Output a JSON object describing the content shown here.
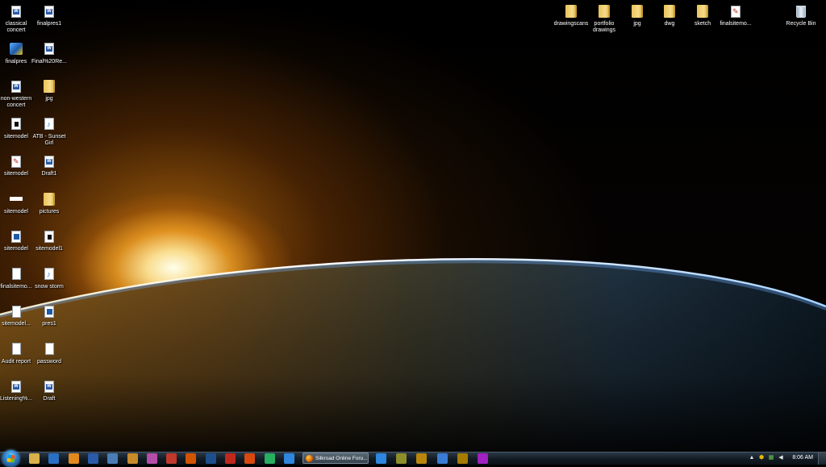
{
  "desktop": {
    "left_icons": [
      {
        "label": "classical concert",
        "icon": "word-doc-icon",
        "kind": "word"
      },
      {
        "label": "finalpres1",
        "icon": "word-doc-icon",
        "kind": "word"
      },
      {
        "label": "finalpres",
        "icon": "program-shortcut-icon",
        "kind": "prog"
      },
      {
        "label": "Final%20Re...",
        "icon": "word-doc-icon",
        "kind": "word"
      },
      {
        "label": "non-western concert",
        "icon": "word-doc-icon",
        "kind": "word"
      },
      {
        "label": "jpg",
        "icon": "folder-icon",
        "kind": "folder"
      },
      {
        "label": "sitemodel",
        "icon": "image-file-icon",
        "kind": "dark"
      },
      {
        "label": "ATB - Sunset Girl",
        "icon": "audio-file-icon",
        "kind": "audio"
      },
      {
        "label": "sitemodel",
        "icon": "autocad-file-icon",
        "kind": "acad"
      },
      {
        "label": "Draft1",
        "icon": "word-doc-icon",
        "kind": "word"
      },
      {
        "label": "sitemodel",
        "icon": "image-file-icon",
        "kind": "flat"
      },
      {
        "label": "pictures",
        "icon": "folder-icon",
        "kind": "folder"
      },
      {
        "label": "sitemodel",
        "icon": "photoshop-file-icon",
        "kind": "pdf"
      },
      {
        "label": "sitemodel1",
        "icon": "image-file-icon",
        "kind": "dark"
      },
      {
        "label": "finalsitemo...",
        "icon": "blank-file-icon",
        "kind": "blank"
      },
      {
        "label": "snow storm",
        "icon": "audio-file-icon",
        "kind": "audio"
      },
      {
        "label": "sitemodel...",
        "icon": "blank-file-icon",
        "kind": "blank"
      },
      {
        "label": "pres1",
        "icon": "photoshop-file-icon",
        "kind": "pdf"
      },
      {
        "label": "Audit report",
        "icon": "blank-file-icon",
        "kind": "blank"
      },
      {
        "label": "password",
        "icon": "blank-file-icon",
        "kind": "blank"
      },
      {
        "label": "Listening%...",
        "icon": "word-doc-icon",
        "kind": "word"
      },
      {
        "label": "Draft",
        "icon": "word-doc-icon",
        "kind": "word"
      }
    ],
    "top_icons": [
      {
        "label": "drawingscans",
        "icon": "folder-icon",
        "kind": "folder"
      },
      {
        "label": "portfolio drawings",
        "icon": "folder-icon",
        "kind": "folder"
      },
      {
        "label": "jpg",
        "icon": "folder-icon",
        "kind": "folder"
      },
      {
        "label": "dwg",
        "icon": "folder-icon",
        "kind": "folder"
      },
      {
        "label": "sketch",
        "icon": "folder-icon",
        "kind": "folder"
      },
      {
        "label": "finalsitemo...",
        "icon": "autocad-file-icon",
        "kind": "acad"
      }
    ],
    "recycle_bin": {
      "label": "Recycle Bin",
      "icon": "recycle-bin-icon"
    }
  },
  "taskbar": {
    "pinned_left": [
      {
        "icon": "folder-icon",
        "color": "#d9b14a"
      },
      {
        "icon": "word-icon",
        "color": "#2a6fc4"
      },
      {
        "icon": "media-player-icon",
        "color": "#e08a1e"
      },
      {
        "icon": "word-icon",
        "color": "#2a5ba8"
      },
      {
        "icon": "document-icon",
        "color": "#4a7db5"
      },
      {
        "icon": "folder-icon",
        "color": "#c98a2a"
      },
      {
        "icon": "photo-icon",
        "color": "#b44da8"
      },
      {
        "icon": "calendar-icon",
        "color": "#c0392b"
      },
      {
        "icon": "powerpoint-icon",
        "color": "#d35400"
      },
      {
        "icon": "photoshop-icon",
        "color": "#1e4f8c"
      },
      {
        "icon": "autocad-icon",
        "color": "#c0281c"
      },
      {
        "icon": "firefox-icon",
        "color": "#d9480f"
      },
      {
        "icon": "chat-icon",
        "color": "#27ae60"
      },
      {
        "icon": "blue-app-icon",
        "color": "#2e86de"
      }
    ],
    "active_task": {
      "label": "Silkroad Online Foru...",
      "icon": "firefox-icon"
    },
    "pinned_right": [
      {
        "icon": "ie-icon",
        "color": "#2e86de"
      },
      {
        "icon": "game-icon",
        "color": "#8e8e2a"
      },
      {
        "icon": "game2-icon",
        "color": "#b8860b"
      },
      {
        "icon": "globe-icon",
        "color": "#3a7bd5"
      },
      {
        "icon": "warcraft-icon",
        "color": "#a67c00"
      },
      {
        "icon": "purple-app-icon",
        "color": "#a020c0"
      }
    ],
    "tray": {
      "expand": "▲",
      "clock": "8:06 AM"
    }
  }
}
